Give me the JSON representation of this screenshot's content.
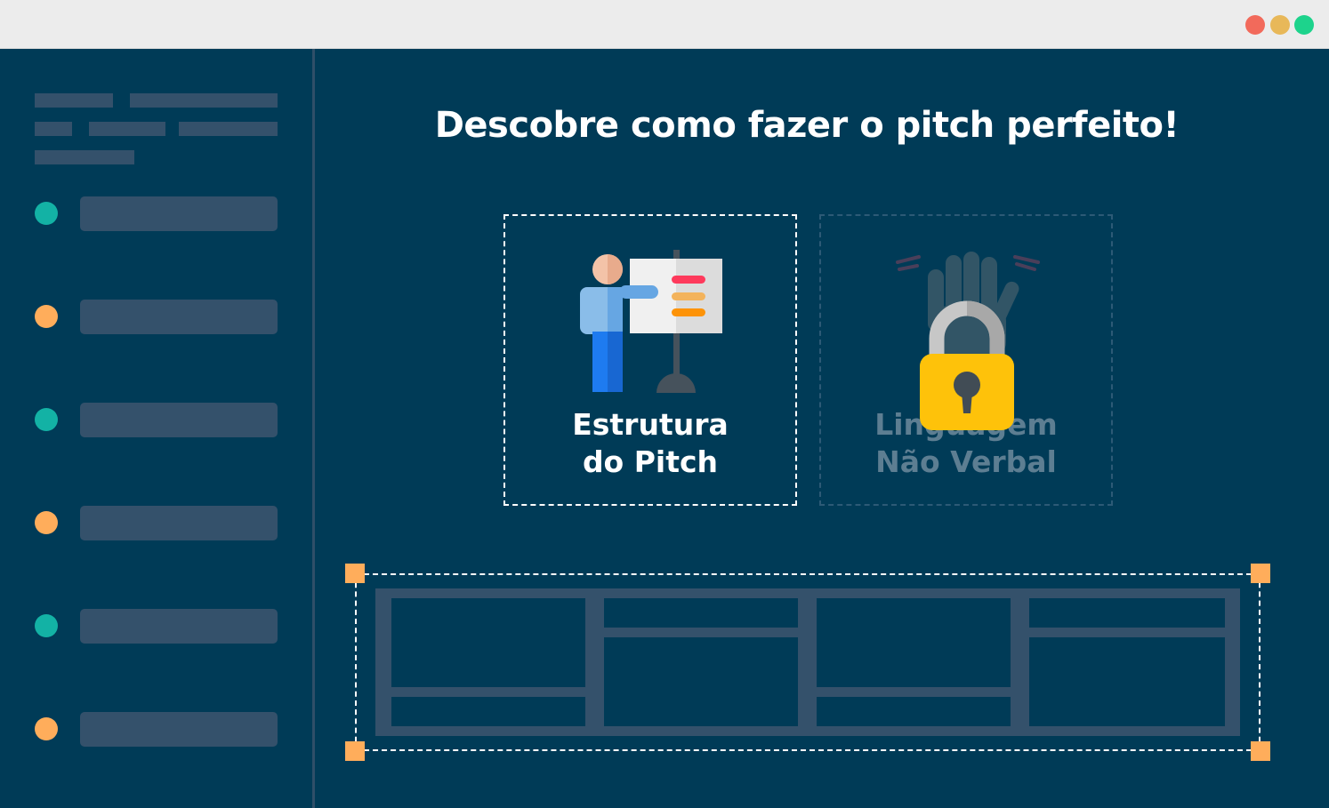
{
  "window": {
    "controls": [
      {
        "name": "close",
        "color": "#f26a5b"
      },
      {
        "name": "minimize",
        "color": "#e8b859"
      },
      {
        "name": "maximize",
        "color": "#1dd38c"
      }
    ]
  },
  "sidebar": {
    "items": [
      {
        "dot_color": "#13b2a5"
      },
      {
        "dot_color": "#ffad5b"
      },
      {
        "dot_color": "#13b2a5"
      },
      {
        "dot_color": "#ffad5b"
      },
      {
        "dot_color": "#13b2a5"
      },
      {
        "dot_color": "#ffad5b"
      }
    ]
  },
  "main": {
    "title": "Descobre como fazer o pitch perfeito!",
    "cards": [
      {
        "line1": "Estrutura",
        "line2": "do Pitch",
        "icon": "presenter-board-icon",
        "locked": false
      },
      {
        "line1": "Linguagem",
        "line2": "Não Verbal",
        "icon": "waving-hand-icon",
        "locked": true,
        "lock_icon": "padlock-icon"
      }
    ]
  },
  "colors": {
    "background": "#003b57",
    "skeleton": "#34516b",
    "accent_orange": "#ffad5b",
    "accent_teal": "#13b2a5",
    "lock_yellow": "#fec20a"
  }
}
